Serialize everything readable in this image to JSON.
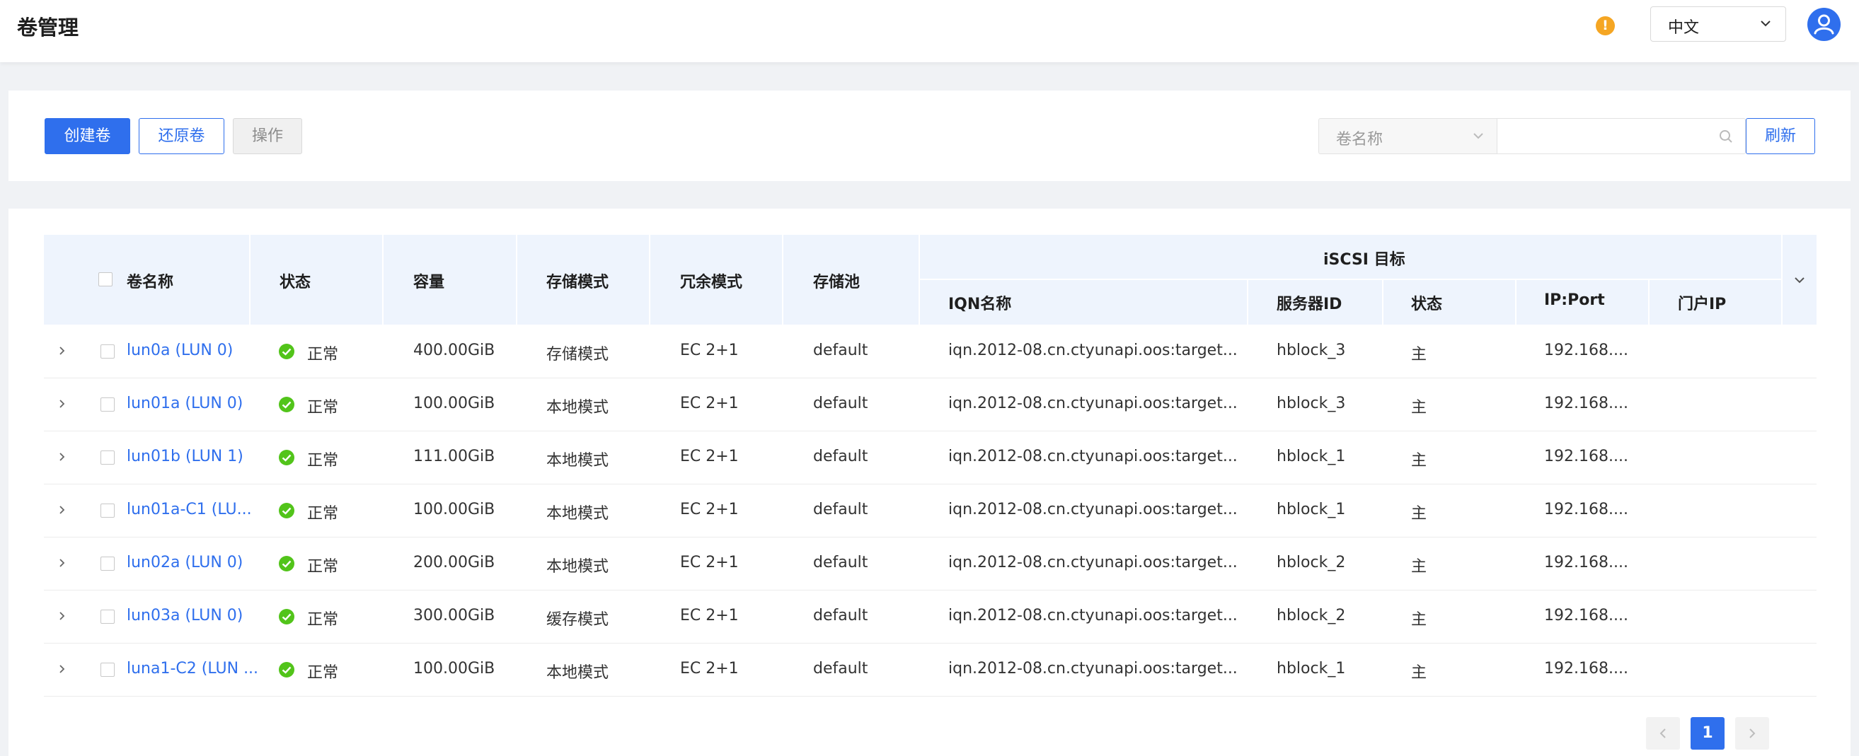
{
  "header": {
    "title": "卷管理",
    "language": "中文"
  },
  "toolbar": {
    "create_label": "创建卷",
    "restore_label": "还原卷",
    "operate_label": "操作",
    "filter_field": "卷名称",
    "search_value": "",
    "refresh_label": "刷新"
  },
  "table": {
    "columns": {
      "name": "卷名称",
      "status": "状态",
      "capacity": "容量",
      "storage_mode": "存储模式",
      "redundancy": "冗余模式",
      "pool": "存储池",
      "iscsi_group": "iSCSI 目标",
      "iqn": "IQN名称",
      "server_id": "服务器ID",
      "target_status": "状态",
      "ip_port": "IP:Port",
      "portal_ip": "门户IP"
    },
    "rows": [
      {
        "name": "lun0a (LUN 0)",
        "status": "正常",
        "capacity": "400.00GiB",
        "storage_mode": "存储模式",
        "redundancy": "EC 2+1",
        "pool": "default",
        "iqn": "iqn.2012-08.cn.ctyunapi.oos:target...",
        "server_id": "hblock_3",
        "target_status": "主",
        "ip_port": "192.168....",
        "portal_ip": ""
      },
      {
        "name": "lun01a (LUN 0)",
        "status": "正常",
        "capacity": "100.00GiB",
        "storage_mode": "本地模式",
        "redundancy": "EC 2+1",
        "pool": "default",
        "iqn": "iqn.2012-08.cn.ctyunapi.oos:target...",
        "server_id": "hblock_3",
        "target_status": "主",
        "ip_port": "192.168....",
        "portal_ip": ""
      },
      {
        "name": "lun01b (LUN 1)",
        "status": "正常",
        "capacity": "111.00GiB",
        "storage_mode": "本地模式",
        "redundancy": "EC 2+1",
        "pool": "default",
        "iqn": "iqn.2012-08.cn.ctyunapi.oos:target...",
        "server_id": "hblock_1",
        "target_status": "主",
        "ip_port": "192.168....",
        "portal_ip": ""
      },
      {
        "name": "lun01a-C1 (LU...",
        "status": "正常",
        "capacity": "100.00GiB",
        "storage_mode": "本地模式",
        "redundancy": "EC 2+1",
        "pool": "default",
        "iqn": "iqn.2012-08.cn.ctyunapi.oos:target...",
        "server_id": "hblock_1",
        "target_status": "主",
        "ip_port": "192.168....",
        "portal_ip": ""
      },
      {
        "name": "lun02a (LUN 0)",
        "status": "正常",
        "capacity": "200.00GiB",
        "storage_mode": "本地模式",
        "redundancy": "EC 2+1",
        "pool": "default",
        "iqn": "iqn.2012-08.cn.ctyunapi.oos:target...",
        "server_id": "hblock_2",
        "target_status": "主",
        "ip_port": "192.168....",
        "portal_ip": ""
      },
      {
        "name": "lun03a (LUN 0)",
        "status": "正常",
        "capacity": "300.00GiB",
        "storage_mode": "缓存模式",
        "redundancy": "EC 2+1",
        "pool": "default",
        "iqn": "iqn.2012-08.cn.ctyunapi.oos:target...",
        "server_id": "hblock_2",
        "target_status": "主",
        "ip_port": "192.168....",
        "portal_ip": ""
      },
      {
        "name": "luna1-C2 (LUN ...",
        "status": "正常",
        "capacity": "100.00GiB",
        "storage_mode": "本地模式",
        "redundancy": "EC 2+1",
        "pool": "default",
        "iqn": "iqn.2012-08.cn.ctyunapi.oos:target...",
        "server_id": "hblock_1",
        "target_status": "主",
        "ip_port": "192.168....",
        "portal_ip": ""
      }
    ]
  },
  "pagination": {
    "current_page": "1"
  },
  "icons": {
    "warning": "warning-icon",
    "avatar": "user-avatar-icon",
    "status_ok": "check-circle-icon",
    "expand": "chevron-right-icon",
    "search": "search-icon"
  },
  "colors": {
    "primary": "#2f6fed",
    "success": "#52c41a",
    "warning": "#f5a623"
  }
}
